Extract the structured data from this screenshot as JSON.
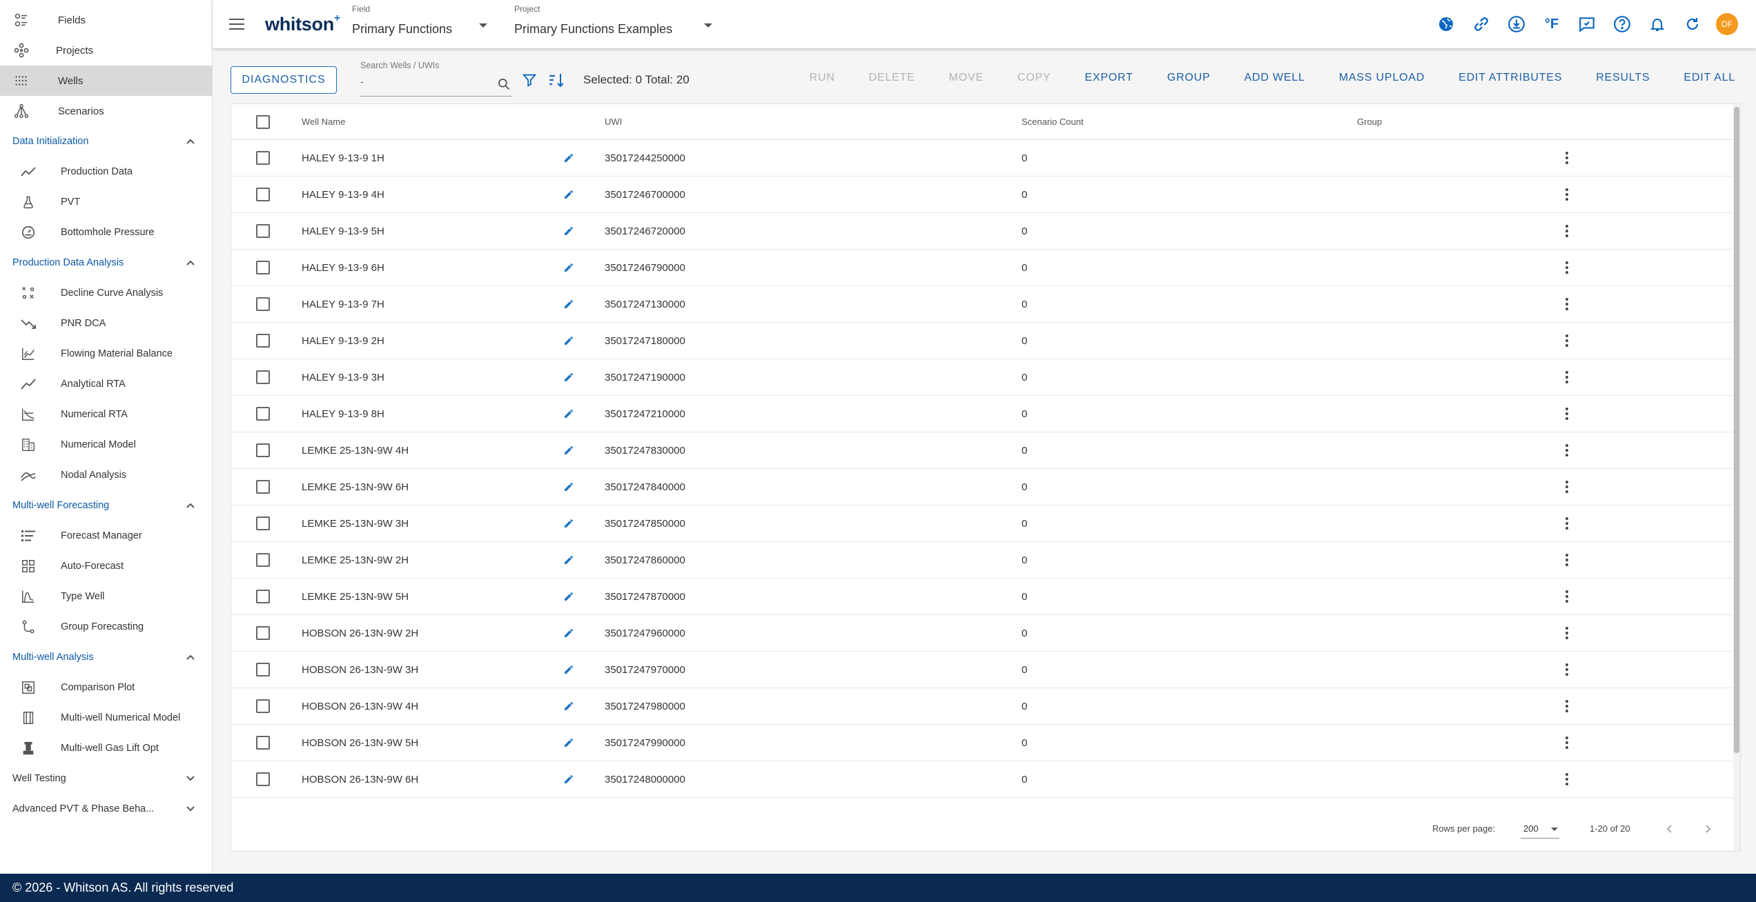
{
  "app": {
    "logo": "whitson",
    "logo_sup": "+"
  },
  "topbar": {
    "field_caption": "Field",
    "field_value": "Primary Functions",
    "project_caption": "Project",
    "project_value": "Primary Functions Examples",
    "units_label": "°F",
    "avatar_initials": "DF",
    "icons": [
      "globe-icon",
      "link-icon",
      "download-icon",
      "units-icon",
      "feedback-icon",
      "help-icon",
      "bell-icon",
      "refresh-icon"
    ]
  },
  "sidebar": {
    "top_items": [
      {
        "label": "Fields",
        "icon": "fields-icon"
      },
      {
        "label": "Projects",
        "icon": "projects-icon"
      },
      {
        "label": "Wells",
        "icon": "wells-icon",
        "active": true
      },
      {
        "label": "Scenarios",
        "icon": "scenarios-icon"
      }
    ],
    "sections": [
      {
        "title": "Data Initialization",
        "expanded": true,
        "items": [
          "Production Data",
          "PVT",
          "Bottomhole Pressure"
        ]
      },
      {
        "title": "Production Data Analysis",
        "expanded": true,
        "items": [
          "Decline Curve Analysis",
          "PNR DCA",
          "Flowing Material Balance",
          "Analytical RTA",
          "Numerical RTA",
          "Numerical Model",
          "Nodal Analysis"
        ]
      },
      {
        "title": "Multi-well Forecasting",
        "expanded": true,
        "items": [
          "Forecast Manager",
          "Auto-Forecast",
          "Type Well",
          "Group Forecasting"
        ]
      },
      {
        "title": "Multi-well Analysis",
        "expanded": true,
        "items": [
          "Comparison Plot",
          "Multi-well Numerical Model",
          "Multi-well Gas Lift Opt"
        ]
      },
      {
        "title": "Well Testing",
        "expanded": false,
        "items": []
      },
      {
        "title": "Advanced PVT & Phase Beha...",
        "expanded": false,
        "items": []
      }
    ]
  },
  "toolbar": {
    "diagnostics_label": "DIAGNOSTICS",
    "search_label": "Search Wells / UWIs",
    "search_value": "-",
    "selected_text": "Selected: 0 Total: 20",
    "actions": [
      {
        "label": "RUN",
        "enabled": false
      },
      {
        "label": "DELETE",
        "enabled": false
      },
      {
        "label": "MOVE",
        "enabled": false
      },
      {
        "label": "COPY",
        "enabled": false
      },
      {
        "label": "EXPORT",
        "enabled": true
      },
      {
        "label": "GROUP",
        "enabled": true
      },
      {
        "label": "ADD WELL",
        "enabled": true
      },
      {
        "label": "MASS UPLOAD",
        "enabled": true
      },
      {
        "label": "EDIT ATTRIBUTES",
        "enabled": true
      },
      {
        "label": "RESULTS",
        "enabled": true
      },
      {
        "label": "EDIT ALL",
        "enabled": true
      }
    ]
  },
  "table": {
    "columns": {
      "name": "Well Name",
      "uwi": "UWI",
      "scenario": "Scenario Count",
      "group": "Group"
    },
    "rows": [
      {
        "name": "HALEY 9-13-9 1H",
        "uwi": "35017244250000",
        "scenario": "0",
        "group": ""
      },
      {
        "name": "HALEY 9-13-9 4H",
        "uwi": "35017246700000",
        "scenario": "0",
        "group": ""
      },
      {
        "name": "HALEY 9-13-9 5H",
        "uwi": "35017246720000",
        "scenario": "0",
        "group": ""
      },
      {
        "name": "HALEY 9-13-9 6H",
        "uwi": "35017246790000",
        "scenario": "0",
        "group": ""
      },
      {
        "name": "HALEY 9-13-9 7H",
        "uwi": "35017247130000",
        "scenario": "0",
        "group": ""
      },
      {
        "name": "HALEY 9-13-9 2H",
        "uwi": "35017247180000",
        "scenario": "0",
        "group": ""
      },
      {
        "name": "HALEY 9-13-9 3H",
        "uwi": "35017247190000",
        "scenario": "0",
        "group": ""
      },
      {
        "name": "HALEY 9-13-9 8H",
        "uwi": "35017247210000",
        "scenario": "0",
        "group": ""
      },
      {
        "name": "LEMKE 25-13N-9W 4H",
        "uwi": "35017247830000",
        "scenario": "0",
        "group": ""
      },
      {
        "name": "LEMKE 25-13N-9W 6H",
        "uwi": "35017247840000",
        "scenario": "0",
        "group": ""
      },
      {
        "name": "LEMKE 25-13N-9W 3H",
        "uwi": "35017247850000",
        "scenario": "0",
        "group": ""
      },
      {
        "name": "LEMKE 25-13N-9W 2H",
        "uwi": "35017247860000",
        "scenario": "0",
        "group": ""
      },
      {
        "name": "LEMKE 25-13N-9W 5H",
        "uwi": "35017247870000",
        "scenario": "0",
        "group": ""
      },
      {
        "name": "HOBSON 26-13N-9W 2H",
        "uwi": "35017247960000",
        "scenario": "0",
        "group": ""
      },
      {
        "name": "HOBSON 26-13N-9W 3H",
        "uwi": "35017247970000",
        "scenario": "0",
        "group": ""
      },
      {
        "name": "HOBSON 26-13N-9W 4H",
        "uwi": "35017247980000",
        "scenario": "0",
        "group": ""
      },
      {
        "name": "HOBSON 26-13N-9W 5H",
        "uwi": "35017247990000",
        "scenario": "0",
        "group": ""
      },
      {
        "name": "HOBSON 26-13N-9W 6H",
        "uwi": "35017248000000",
        "scenario": "0",
        "group": ""
      }
    ]
  },
  "pagination": {
    "rows_per_page_label": "Rows per page:",
    "rows_per_page_value": "200",
    "range_text": "1-20 of 20"
  },
  "footer": {
    "text": "© 2026 - Whitson AS. All rights reserved"
  },
  "colors": {
    "accent": "#1a73c8",
    "brand_navy": "#0b2a52",
    "avatar": "#f59a1e",
    "disabled": "#b3b3b3"
  }
}
